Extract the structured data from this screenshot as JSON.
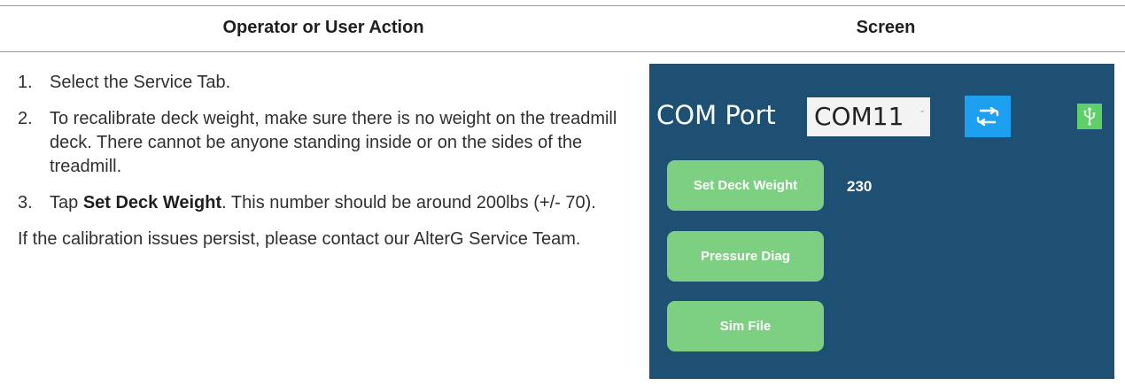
{
  "table": {
    "header_left": "Operator or User Action",
    "header_right": "Screen"
  },
  "steps": [
    {
      "num": "1.",
      "text": "Select the Service Tab."
    },
    {
      "num": "2.",
      "text": "To recalibrate deck weight, make sure there is no weight on the treadmill deck. There cannot be anyone standing inside or on the sides of the treadmill."
    },
    {
      "num": "3.",
      "pre": "Tap ",
      "bold": "Set Deck Weight",
      "post": ". This number should be around 200lbs (+/- 70)."
    }
  ],
  "note": "If the calibration issues persist, please contact our AlterG Service Team.",
  "screen": {
    "com_label": "COM Port",
    "com_value": "COM11",
    "chevron_glyph": "ˇ",
    "refresh_icon": "refresh-icon",
    "usb_icon": "usb-icon",
    "set_deck_weight_label": "Set Deck Weight",
    "deck_weight_value": "230",
    "pressure_diag_label": "Pressure Diag",
    "sim_file_label": "Sim File",
    "colors": {
      "panel_bg": "#1e5074",
      "button_green": "#7dd082",
      "refresh_blue": "#1ea0f0",
      "usb_green": "#5fcf6a"
    }
  }
}
